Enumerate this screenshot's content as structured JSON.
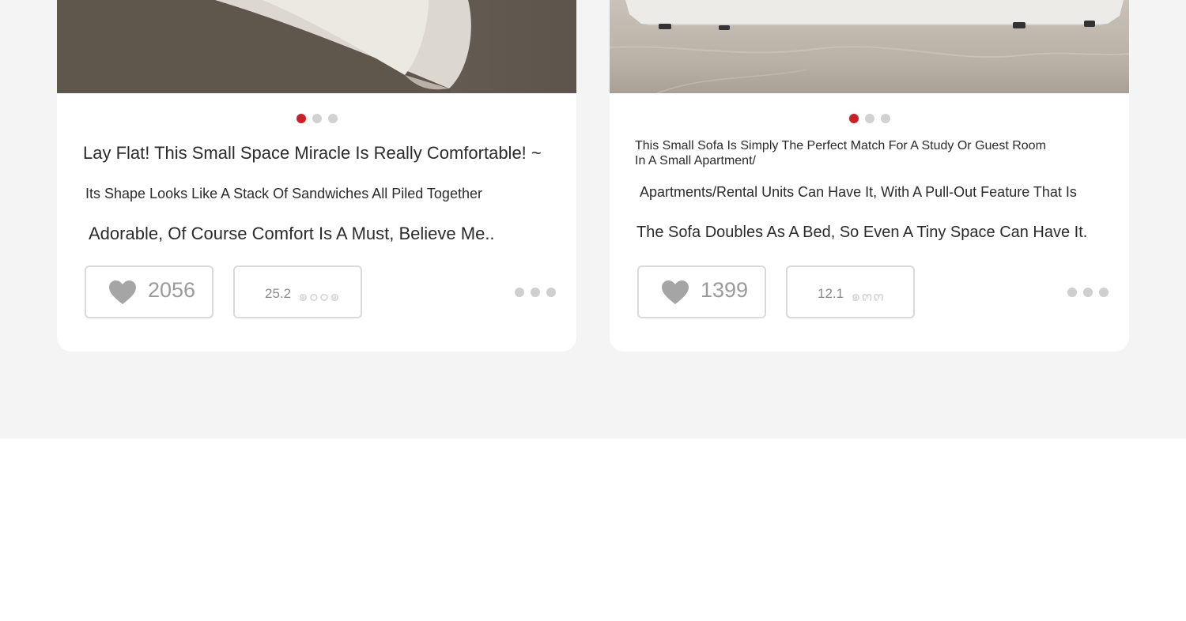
{
  "cards": [
    {
      "caption_lines": [
        "Lay Flat! This Small Space Miracle Is Really Comfortable! ~",
        "Its Shape Looks Like A Stack Of Sandwiches All Piled Together",
        "Adorable, Of Course Comfort Is A Must, Believe Me.."
      ],
      "likes": "2056",
      "share_value": "25.2",
      "share_faded": "๑๐๐๑",
      "carousel_active_index": 0,
      "carousel_count": 3,
      "icons": {
        "like": "heart-icon",
        "more": "more-icon"
      }
    },
    {
      "caption_lines": [
        "This Small Sofa Is Simply The Perfect Match For A Study Or Guest Room",
        "In A Small Apartment/",
        "Apartments/Rental Units Can Have It, With A Pull-Out Feature That Is",
        "The Sofa Doubles As A Bed, So Even A Tiny Space Can Have It."
      ],
      "likes": "1399",
      "share_value": "12.1",
      "share_faded": "๑๓๓",
      "carousel_active_index": 0,
      "carousel_count": 3,
      "icons": {
        "like": "heart-icon",
        "more": "more-icon"
      }
    }
  ],
  "colors": {
    "accent": "#cf1f26",
    "feed_background": "#f4f4f5",
    "card_background": "#ffffff",
    "text": "#2b2b2b",
    "muted": "#9a9a9a"
  }
}
